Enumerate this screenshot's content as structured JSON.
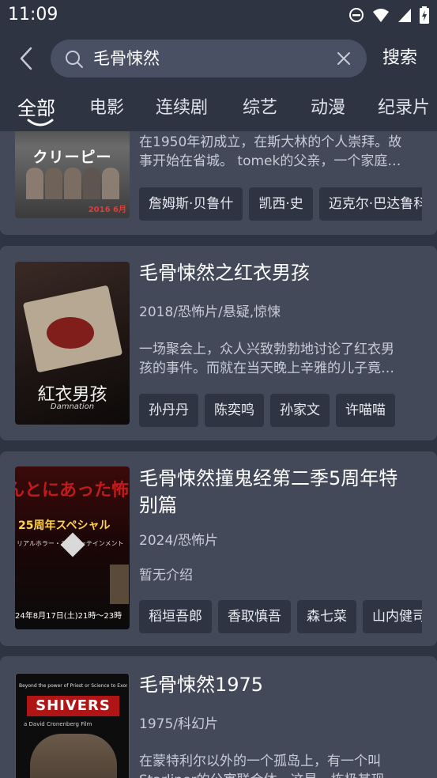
{
  "status_bar": {
    "time": "11:09"
  },
  "search": {
    "query": "毛骨悚然",
    "submit_label": "搜索"
  },
  "tabs": [
    {
      "label": "全部",
      "active": true
    },
    {
      "label": "电影"
    },
    {
      "label": "连续剧"
    },
    {
      "label": "综艺"
    },
    {
      "label": "动漫"
    },
    {
      "label": "纪录片"
    }
  ],
  "results": [
    {
      "title": "",
      "meta": "",
      "desc_line1": "在1950年初成立，在斯大林的个人崇拜。故",
      "desc_line2": "事开始在省城。 tomek的父亲，一个家庭…",
      "actors": [
        "詹姆斯·贝鲁什",
        "凯西·史",
        "迈克尔·巴达鲁科"
      ],
      "poster_text": "クリーピー",
      "poster_small": "2016 6月"
    },
    {
      "title": "毛骨悚然之红衣男孩",
      "meta": "2018/恐怖片/悬疑,惊悚",
      "desc_line1": "一场聚会上，众人兴致勃勃地讨论了红衣男",
      "desc_line2": "孩的事件。而就在当天晚上辛雅的儿子竟…",
      "actors": [
        "孙丹丹",
        "陈奕鸣",
        "孙家文",
        "许喵喵"
      ],
      "poster_text": "紅衣男孩",
      "poster_small": "Damnation"
    },
    {
      "title_line1": "毛骨悚然撞鬼经第二季5周年特",
      "title_line2": "别篇",
      "meta": "2024/恐怖片",
      "desc_line1": "暂无介绍",
      "actors": [
        "稻垣吾郎",
        "香取慎吾",
        "森七菜",
        "山内健司"
      ],
      "poster_text_top": "んとにあった怖い話",
      "poster_text_mid": "25周年スペシャル",
      "poster_text_low": "リアルホラー・エンターテインメント",
      "poster_text_bottom": "24年8月17日(土)21時～23時"
    },
    {
      "title": "毛骨悚然1975",
      "meta": "1975/科幻片",
      "desc_line1": "在蒙特利尔以外的一个孤岛上，有一个叫",
      "desc_line2": "Starliner的公寓联合体，这是一栋极其现…",
      "poster_text_top": "Beyond the power of Priest or Science to Exorcise!",
      "poster_text": "SHIVERS",
      "poster_small": "a David Cronenberg Film"
    }
  ],
  "colors": {
    "background": "#2f3443",
    "card": "#434959",
    "search_box": "#4a5064",
    "chip": "#2f3443"
  }
}
